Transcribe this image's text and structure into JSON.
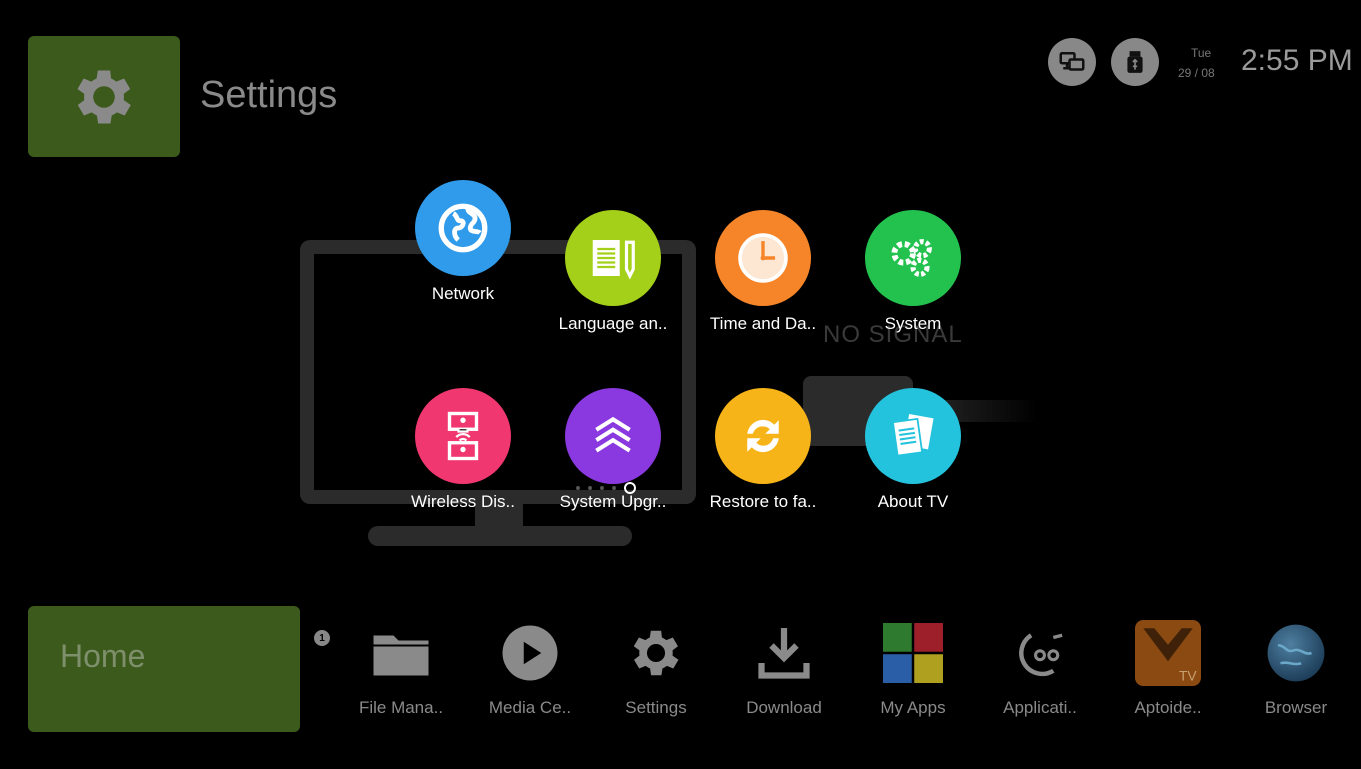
{
  "header": {
    "title": "Settings",
    "date_day": "Tue",
    "date_num": "29 / 08",
    "time": "2:55 PM"
  },
  "background": {
    "no_signal": "NO SIGNAL"
  },
  "options": [
    {
      "label": "Network",
      "icon": "globe-icon",
      "color": "#2f9bea"
    },
    {
      "label": "Language an..",
      "icon": "document-pencil-icon",
      "color": "#a4d01a"
    },
    {
      "label": "Time and Da..",
      "icon": "clock-icon",
      "color": "#f58528"
    },
    {
      "label": "System",
      "icon": "gears-icon",
      "color": "#23c24f"
    },
    {
      "label": "Wireless Dis..",
      "icon": "wireless-display-icon",
      "color": "#f0376f"
    },
    {
      "label": "System Upgr..",
      "icon": "upgrade-chevrons-icon",
      "color": "#8a39e0"
    },
    {
      "label": "Restore to fa..",
      "icon": "refresh-icon",
      "color": "#f6b419"
    },
    {
      "label": "About TV",
      "icon": "documents-icon",
      "color": "#24c3dd"
    }
  ],
  "bottom": {
    "home_label": "Home",
    "badge_count": "1",
    "apps": [
      {
        "label": "File Mana..",
        "icon": "folder-icon"
      },
      {
        "label": "Media Ce..",
        "icon": "play-icon"
      },
      {
        "label": "Settings",
        "icon": "gear-icon"
      },
      {
        "label": "Download",
        "icon": "download-icon"
      },
      {
        "label": "My Apps",
        "icon": "apps-grid-icon"
      },
      {
        "label": "Applicati..",
        "icon": "application-store-icon"
      },
      {
        "label": "Aptoide..",
        "icon": "aptoide-icon"
      },
      {
        "label": "Browser",
        "icon": "globe-browser-icon"
      }
    ]
  },
  "colors": {
    "accent_green": "#3c5a1b",
    "text_dim": "#8a8a8a"
  }
}
